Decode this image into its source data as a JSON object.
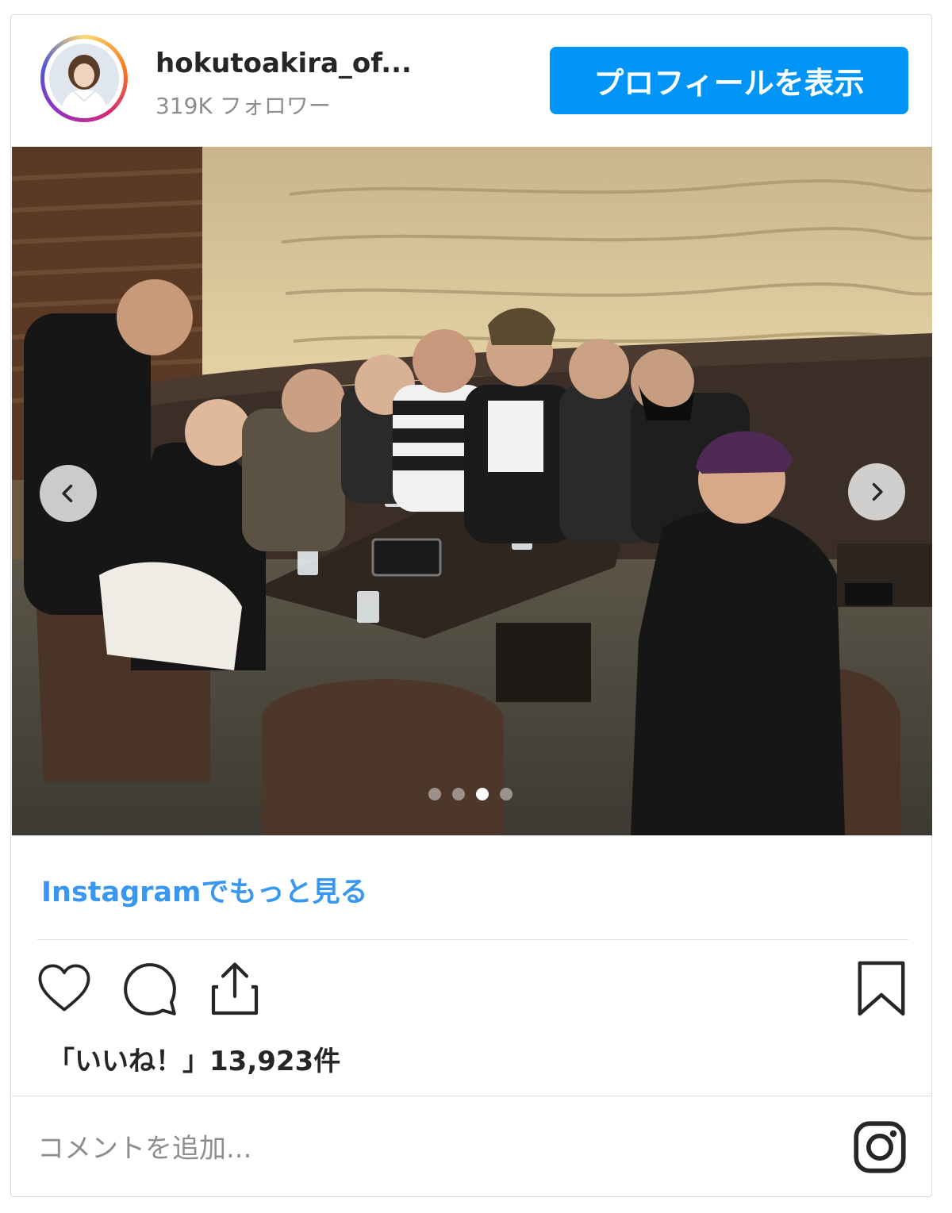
{
  "post": {
    "username": "hokutoakira_of...",
    "followers": "319K フォロワー",
    "profile_button_label": "プロフィールを表示",
    "more_link": "Instagramでもっと見る",
    "likes_text": "「いいね！」13,923件",
    "comment_placeholder": "コメントを追加...",
    "carousel": {
      "total_slides": 4,
      "active_slide": 3
    }
  },
  "icons": {
    "like": "heart-icon",
    "comment": "comment-icon",
    "share": "share-icon",
    "save": "bookmark-icon",
    "prev": "chevron-left-icon",
    "next": "chevron-right-icon",
    "brand": "instagram-icon"
  },
  "colors": {
    "button_blue": "#0095f6",
    "link_blue": "#3897f0",
    "text": "#262626",
    "muted": "#8e8e8e",
    "border": "#dbdbdb"
  }
}
